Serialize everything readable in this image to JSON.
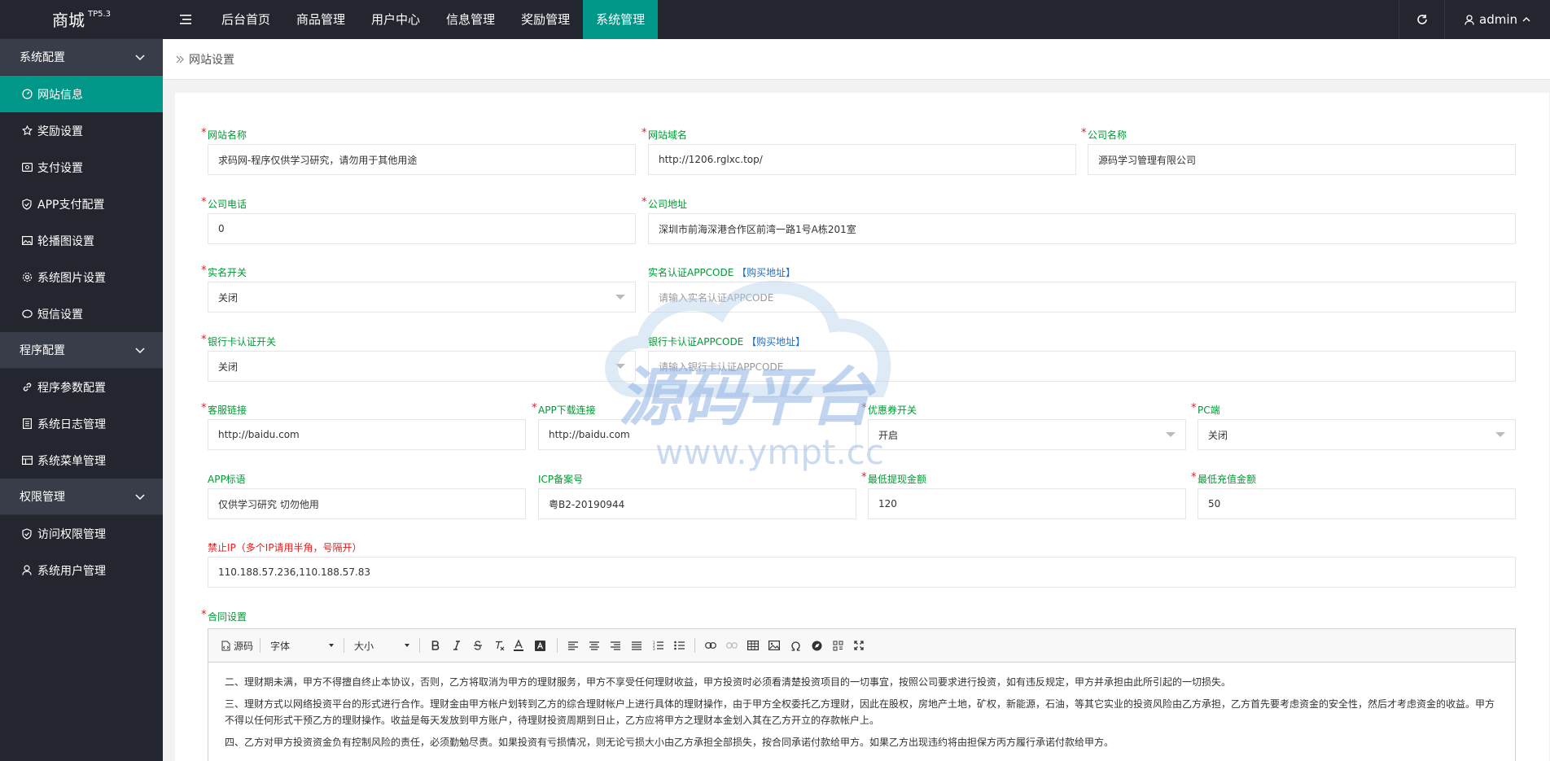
{
  "brand": {
    "name": "商城",
    "version": "TP5.3"
  },
  "topnav": [
    {
      "label": "后台首页"
    },
    {
      "label": "商品管理"
    },
    {
      "label": "用户中心"
    },
    {
      "label": "信息管理"
    },
    {
      "label": "奖励管理"
    },
    {
      "label": "系统管理"
    }
  ],
  "user": {
    "name": "admin"
  },
  "sidebar": {
    "group1": "系统配置",
    "group1_items": [
      {
        "label": "网站信息",
        "icon": "dashboard-icon"
      },
      {
        "label": "奖励设置",
        "icon": "star-icon"
      },
      {
        "label": "支付设置",
        "icon": "wallet-icon"
      },
      {
        "label": "APP支付配置",
        "icon": "shield-check-icon"
      },
      {
        "label": "轮播图设置",
        "icon": "image-icon"
      },
      {
        "label": "系统图片设置",
        "icon": "gear-icon"
      },
      {
        "label": "短信设置",
        "icon": "message-icon"
      }
    ],
    "group2": "程序配置",
    "group2_items": [
      {
        "label": "程序参数配置",
        "icon": "link-icon"
      },
      {
        "label": "系统日志管理",
        "icon": "list-icon"
      },
      {
        "label": "系统菜单管理",
        "icon": "table-icon"
      }
    ],
    "group3": "权限管理",
    "group3_items": [
      {
        "label": "访问权限管理",
        "icon": "shield-check-icon"
      },
      {
        "label": "系统用户管理",
        "icon": "user-icon"
      }
    ]
  },
  "breadcrumb": "网站设置",
  "form": {
    "site_name": {
      "label": "网站名称",
      "value": "求码网-程序仅供学习研究，请勿用于其他用途"
    },
    "site_domain": {
      "label": "网站域名",
      "value": "http://1206.rglxc.top/"
    },
    "company_name": {
      "label": "公司名称",
      "value": "源码学习管理有限公司"
    },
    "company_phone": {
      "label": "公司电话",
      "value": "0"
    },
    "company_address": {
      "label": "公司地址",
      "value": "深圳市前海深港合作区前湾一路1号A栋201室"
    },
    "realname_switch": {
      "label": "实名开关",
      "value": "关闭"
    },
    "realname_appcode": {
      "label": "实名认证APPCODE",
      "buy": "【购买地址】",
      "placeholder": "请输入实名认证APPCODE"
    },
    "bankcard_switch": {
      "label": "银行卡认证开关",
      "value": "关闭"
    },
    "bankcard_appcode": {
      "label": "银行卡认证APPCODE",
      "buy": "【购买地址】",
      "placeholder": "请输入银行卡认证APPCODE"
    },
    "service_link": {
      "label": "客服链接",
      "value": "http://baidu.com"
    },
    "app_download": {
      "label": "APP下载连接",
      "value": "http://baidu.com"
    },
    "coupon_switch": {
      "label": "优惠券开关",
      "value": "开启"
    },
    "pc_switch": {
      "label": "PC端",
      "value": "关闭"
    },
    "app_slogan": {
      "label": "APP标语",
      "value": "仅供学习研究 切勿他用"
    },
    "icp": {
      "label": "ICP备案号",
      "value": "粤B2-20190944"
    },
    "min_withdraw": {
      "label": "最低提现金额",
      "value": "120"
    },
    "min_recharge": {
      "label": "最低充值金额",
      "value": "50"
    },
    "banned_ip": {
      "label": "禁止IP（多个IP请用半角，号隔开）",
      "value": "110.188.57.236,110.188.57.83"
    },
    "contract": {
      "label": "合同设置"
    }
  },
  "editor": {
    "source_label": "源码",
    "font_label": "字体",
    "size_label": "大小",
    "paragraphs": [
      "二、理财期未满，甲方不得擅自终止本协议，否则，乙方将取消为甲方的理财服务，甲方不享受任何理财收益，甲方投资时必须看清楚投资项目的一切事宜，按照公司要求进行投资，如有违反规定，甲方并承担由此所引起的一切损失。",
      "三、理财方式以网络投资平台的形式进行合作。理财金由甲方帐户划转到乙方的综合理财帐户上进行具体的理财操作，由于甲方全权委托乙方理财，因此在股权，房地产土地，矿权，新能源，石油，等其它实业的投资风险由乙方承担，乙方首先要考虑资金的安全性，然后才考虑资金的收益。甲方不得以任何形式干预乙方的理财操作。收益是每天发放到甲方账户，待理财投资周期到日止，乙方应将甲方之理财本金划入其在乙方开立的存款帐户上。",
      "四、乙方对甲方投资资金负有控制风险的责任，必须勤勉尽责。如果投资有亏损情况，则无论亏损大小由乙方承担全部损失，按合同承诺付款给甲方。如果乙方出现违约将由担保方丙方履行承诺付款给甲方。"
    ]
  },
  "watermark": {
    "title": "源码平台",
    "url": "www.ympt.cc"
  },
  "colors": {
    "accent": "#009688",
    "dark": "#23262e",
    "label_green": "#009933",
    "required_red": "#e02020"
  }
}
